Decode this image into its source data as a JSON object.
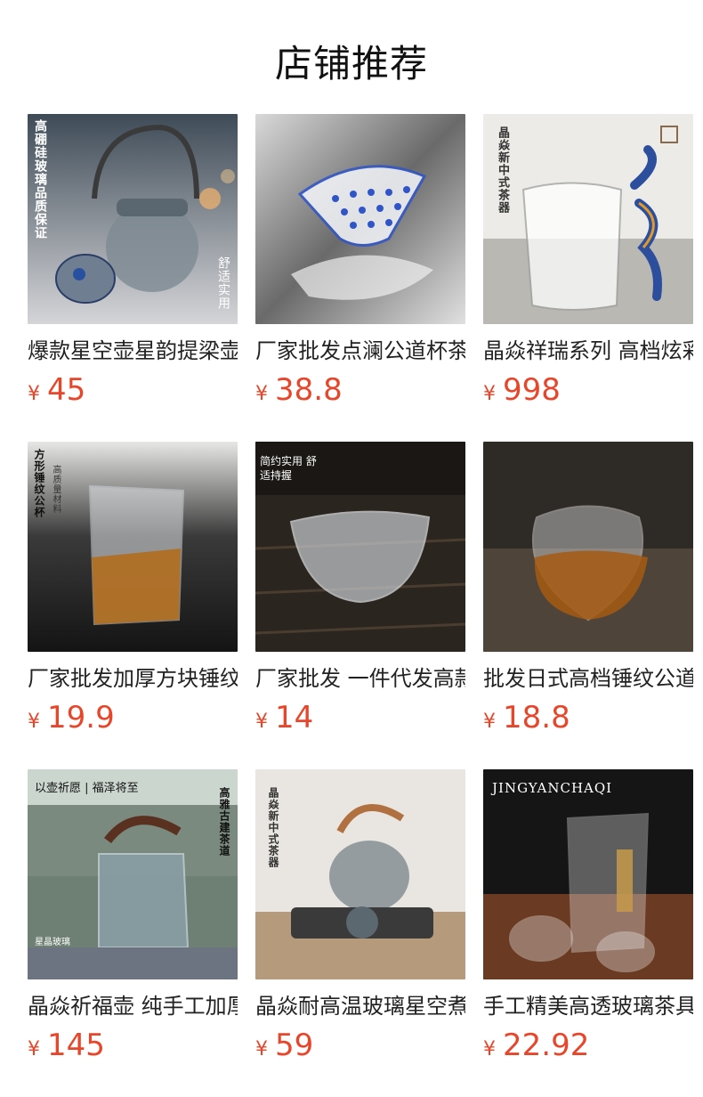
{
  "page_title": "店铺推荐",
  "currency_symbol": "¥",
  "products": [
    {
      "name": "爆款星空壶星韵提梁壶",
      "price": "45",
      "badge": "高硼硅玻璃品质保证",
      "side": "舒适实用",
      "bg_a": "#4c5a68",
      "bg_b": "#c8c9cd"
    },
    {
      "name": "厂家批发点澜公道杯茶海",
      "price": "38.8",
      "bg_a": "#2e2e2e",
      "bg_b": "#f0f0f0"
    },
    {
      "name": "晶焱祥瑞系列 高档炫彩公道杯",
      "price": "998",
      "badge": "晶焱新中式茶器",
      "bg_a": "#f3f3f1",
      "bg_b": "#cfcfca"
    },
    {
      "name": "厂家批发加厚方块锤纹公杯",
      "price": "19.9",
      "badge": "方形锤纹公杯",
      "side": "高质量材料",
      "bg_a": "#1b1b1b",
      "bg_b": "#4b4b4b"
    },
    {
      "name": "厂家批发 一件代发高款锤纹公杯",
      "price": "14",
      "badge": "简约实用 舒适持握",
      "bg_a": "#2a2520",
      "bg_b": "#5a4b3a"
    },
    {
      "name": "批发日式高档锤纹公道杯",
      "price": "18.8",
      "bg_a": "#262626",
      "bg_b": "#5a4f45"
    },
    {
      "name": "晶焱祈福壶 纯手工加厚煮茶壶",
      "price": "145",
      "badge": "以壶祈愿 | 福泽将至",
      "side": "高雅古建茶道",
      "brand_mark": "星晶玻璃",
      "bg_a": "#6e8a77",
      "bg_b": "#4f5964"
    },
    {
      "name": "晶焱耐高温玻璃星空煮茶壶",
      "price": "59",
      "badge": "晶焱新中式茶器",
      "bg_a": "#e8e4df",
      "bg_b": "#9b7355"
    },
    {
      "name": "手工精美高透玻璃茶具套装",
      "price": "22.92",
      "badge": "JINGYANCHAQI",
      "bg_a": "#161616",
      "bg_b": "#6a3a22"
    }
  ]
}
